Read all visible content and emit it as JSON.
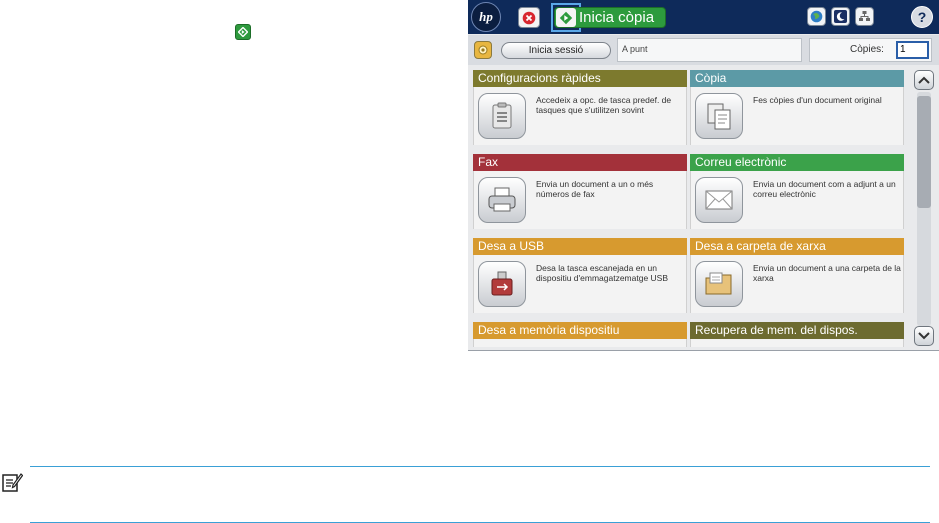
{
  "panel": {
    "logo": "hp",
    "start_label": "Inicia còpia",
    "toolbar_icons": [
      "globe-icon",
      "sleep-icon",
      "network-icon"
    ],
    "help_label": "?",
    "signin_label": "Inicia sessió",
    "status_text": "A punt",
    "copies_label": "Còpies:",
    "copies_value": "1"
  },
  "tiles": [
    {
      "title": "Configuracions ràpides",
      "desc": "Accedeix a opc. de tasca predef. de tasques que s'utilitzen sovint",
      "color": "#7d7a2e",
      "icon": "quick-sets-icon"
    },
    {
      "title": "Còpia",
      "desc": "Fes còpies d'un document original",
      "color": "#5c9aa6",
      "icon": "copy-icon"
    },
    {
      "title": "Fax",
      "desc": "Envia un document a un o més números de fax",
      "color": "#a3313a",
      "icon": "fax-icon"
    },
    {
      "title": "Correu electrònic",
      "desc": "Envia un document com a adjunt a un correu electrònic",
      "color": "#3ba24a",
      "icon": "email-icon"
    },
    {
      "title": "Desa a USB",
      "desc": "Desa la tasca escanejada en un dispositiu d'emmagatzematge USB",
      "color": "#d79a2f",
      "icon": "usb-icon"
    },
    {
      "title": "Desa a carpeta de xarxa",
      "desc": "Envia un document a una carpeta de la xarxa",
      "color": "#d79a2f",
      "icon": "network-folder-icon"
    },
    {
      "title": "Desa a memòria dispositiu",
      "desc": "",
      "color": "#d79a2f",
      "icon": ""
    },
    {
      "title": "Recupera de mem. del dispos.",
      "desc": "",
      "color": "#6d6b30",
      "icon": ""
    }
  ]
}
